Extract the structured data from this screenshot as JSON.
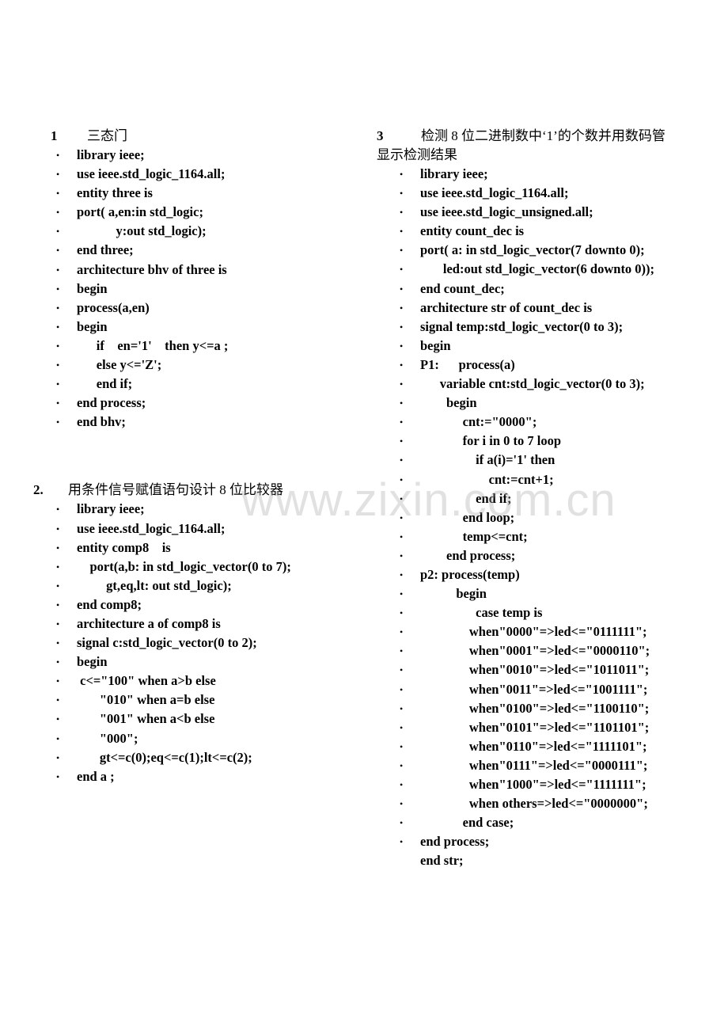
{
  "watermark": "www.zixin.com.cn",
  "sections": {
    "s1": {
      "number": "1",
      "title": "三态门",
      "lines": [
        "library ieee;",
        "use ieee.std_logic_1164.all;",
        "entity three is",
        "port( a,en:in std_logic;",
        "            y:out std_logic);",
        "end three;",
        "architecture bhv of three is",
        "begin",
        "process(a,en)",
        "begin",
        "      if    en='1'    then y<=a ;",
        "      else y<='Z';",
        "      end if;",
        "end process;",
        "end bhv;"
      ]
    },
    "s2": {
      "number": "2.",
      "title": "用条件信号赋值语句设计 8 位比较器",
      "lines": [
        "library ieee;",
        "use ieee.std_logic_1164.all;",
        "entity comp8    is",
        "    port(a,b: in std_logic_vector(0 to 7);",
        "         gt,eq,lt: out std_logic);",
        "end comp8;",
        "architecture a of comp8 is",
        "signal c:std_logic_vector(0 to 2);",
        "begin",
        " c<=\"100\" when a>b else",
        "       \"010\" when a=b else",
        "       \"001\" when a<b else",
        "       \"000\";",
        "       gt<=c(0);eq<=c(1);lt<=c(2);",
        "end a ;"
      ]
    },
    "s3": {
      "number": "3",
      "title_line1": "检测 8 位二进制数中‘1’的个数并用数码管",
      "title_line2": "显示检测结果",
      "lines": [
        "library ieee;",
        "use ieee.std_logic_1164.all;",
        "use ieee.std_logic_unsigned.all;",
        "entity count_dec is",
        "port( a: in std_logic_vector(7 downto 0);",
        "       led:out std_logic_vector(6 downto 0));",
        "end count_dec;",
        "architecture str of count_dec is",
        "signal temp:std_logic_vector(0 to 3);",
        "begin",
        "P1:      process(a)",
        "      variable cnt:std_logic_vector(0 to 3);",
        "        begin",
        "             cnt:=\"0000\";",
        "             for i in 0 to 7 loop",
        "                 if a(i)='1' then",
        "                     cnt:=cnt+1;",
        "                 end if;",
        "             end loop;",
        "             temp<=cnt;",
        "        end process;",
        "p2: process(temp)",
        "           begin",
        "                 case temp is",
        "               when\"0000\"=>led<=\"0111111\";",
        "               when\"0001\"=>led<=\"0000110\";",
        "               when\"0010\"=>led<=\"1011011\";",
        "               when\"0011\"=>led<=\"1001111\";",
        "               when\"0100\"=>led<=\"1100110\";",
        "               when\"0101\"=>led<=\"1101101\";",
        "               when\"0110\"=>led<=\"1111101\";",
        "               when\"0111\"=>led<=\"0000111\";",
        "               when\"1000\"=>led<=\"1111111\";",
        "               when others=>led<=\"0000000\";",
        "             end case;",
        "end process;",
        "end str;"
      ]
    }
  }
}
